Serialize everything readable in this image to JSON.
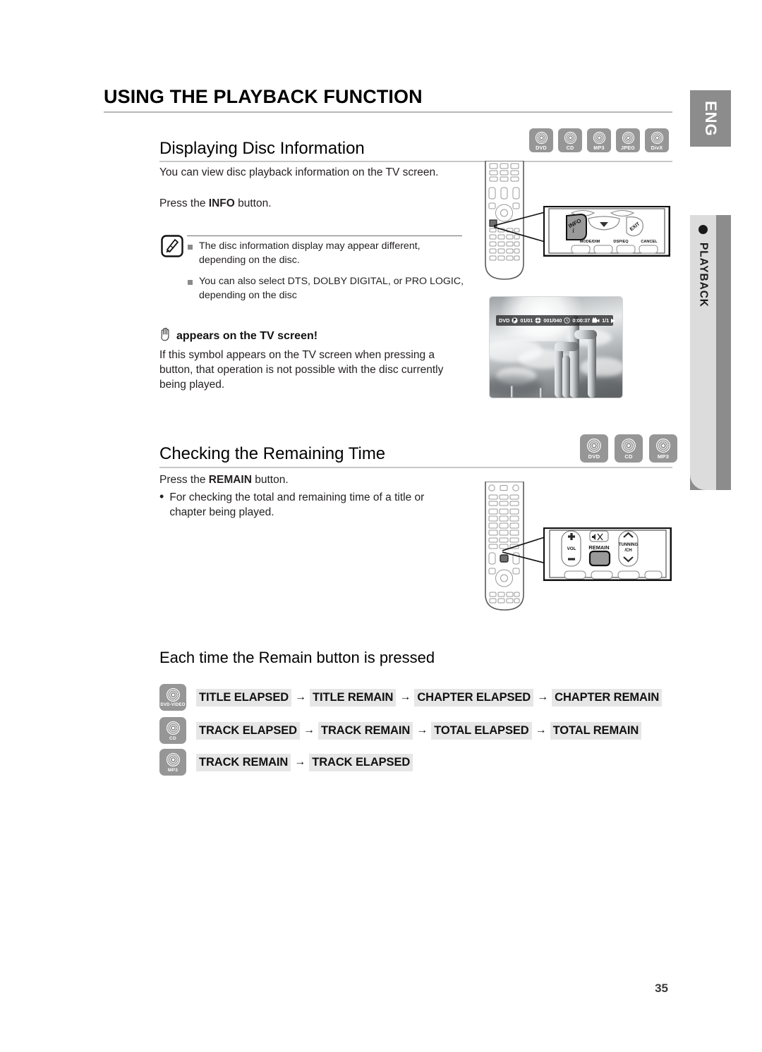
{
  "page": {
    "number": "35",
    "title": "USING THE PLAYBACK FUNCTION"
  },
  "side_tabs": {
    "language": "ENG",
    "chapter": "PLAYBACK"
  },
  "sections": [
    {
      "id": "displaying-disc-information",
      "heading": "Displaying Disc Information",
      "disc_icons": [
        "DVD",
        "CD",
        "MP3",
        "JPEG",
        "DivX"
      ],
      "intro": "You can view disc playback information  on the TV screen.",
      "instruction_prefix": "Press the ",
      "instruction_button": "INFO",
      "instruction_suffix": " button.",
      "notes": [
        "The disc information display may appear different, depending on the disc.",
        "You can also  select DTS, DOLBY DIGITAL, or PRO LOGIC, depending on the disc"
      ],
      "warning": {
        "icon": "hand-icon",
        "heading": "appears on the TV screen!",
        "body": "If this symbol appears on the TV screen when pressing a button, that operation is not possible with the disc currently being played."
      },
      "tv_osd": {
        "disc_type": "DVD",
        "title_indicator": "01/01",
        "chapter_indicator": "001/040",
        "time": "0:00:37",
        "angle": "1/1",
        "play_symbol": "▶"
      },
      "remote_callout": {
        "highlight_button": "INFO",
        "nearby_labels": [
          "DSP/EQ",
          "CANCEL"
        ]
      }
    },
    {
      "id": "checking-the-remaining-time",
      "heading": "Checking the Remaining Time",
      "disc_icons": [
        "DVD",
        "CD",
        "MP3"
      ],
      "instruction_prefix": "Press the ",
      "instruction_button": "REMAIN",
      "instruction_suffix": " button.",
      "bullets": [
        "For checking the total and remaining time of a title or chapter being played."
      ],
      "remote_callout": {
        "highlight_button": "REMAIN",
        "nearby_labels": [
          "VOL",
          "TUNNING",
          "/CH"
        ]
      }
    }
  ],
  "sequence_block": {
    "heading": "Each time the Remain button is pressed",
    "arrow": "→",
    "rows": [
      {
        "disc": "DVD-VIDEO",
        "steps": [
          "TITLE ELAPSED",
          "TITLE REMAIN",
          "CHAPTER ELAPSED",
          "CHAPTER REMAIN"
        ]
      },
      {
        "disc": "CD",
        "steps": [
          "TRACK ELAPSED",
          "TRACK REMAIN",
          "TOTAL ELAPSED",
          "TOTAL REMAIN"
        ]
      },
      {
        "disc": "MP3",
        "steps": [
          "TRACK REMAIN",
          "TRACK ELAPSED"
        ]
      }
    ]
  },
  "colors": {
    "disc_chip": "#969696",
    "pill": "#e6e6e6",
    "side_tab": "#8c8c8c",
    "chapter_tab_inner": "#dcdcdc",
    "text": "#231f20"
  }
}
